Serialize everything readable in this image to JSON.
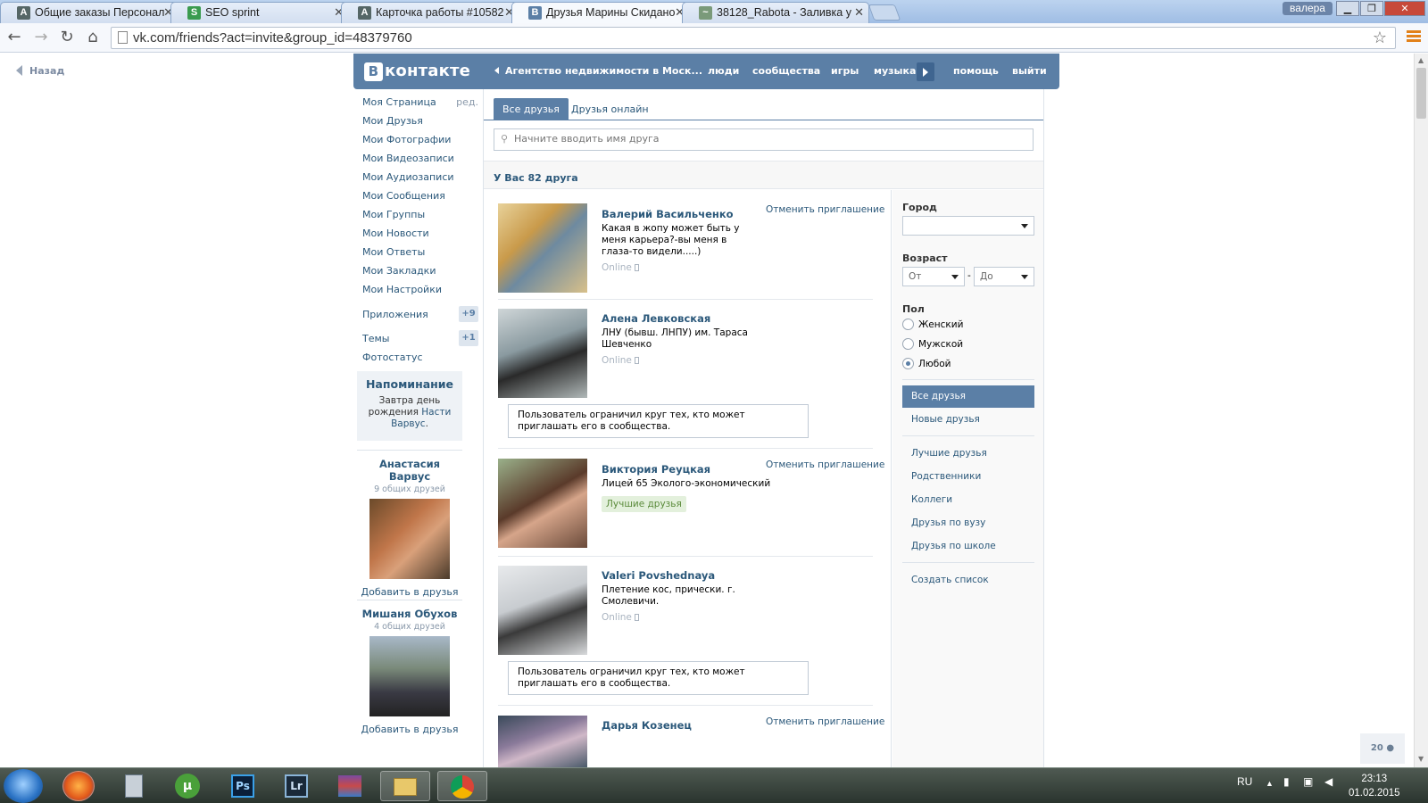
{
  "browser": {
    "tabs": [
      {
        "label": "Общие заказы Персонал",
        "icon": "A"
      },
      {
        "label": "SEO sprint",
        "icon": "S"
      },
      {
        "label": "Карточка работы #10582",
        "icon": "A"
      },
      {
        "label": "Друзья Марины Скидано",
        "icon": "B"
      },
      {
        "label": "38128_Rabota - Заливка у",
        "icon": "~"
      }
    ],
    "user": "валера",
    "url": "vk.com/friends?act=invite&group_id=48379760"
  },
  "page": {
    "back_label": "Назад",
    "logo": {
      "letter": "B",
      "text": "контакте"
    },
    "nav": {
      "group": "Агентство недвижимости в Моск...",
      "people": "люди",
      "communities": "сообщества",
      "games": "игры",
      "music": "музыка",
      "help": "помощь",
      "logout": "выйти"
    },
    "menu": {
      "edit": "ред.",
      "items": [
        "Моя Страница",
        "Мои Друзья",
        "Мои Фотографии",
        "Мои Видеозаписи",
        "Мои Аудиозаписи",
        "Мои Сообщения",
        "Мои Группы",
        "Мои Новости",
        "Мои Ответы",
        "Мои Закладки",
        "Мои Настройки"
      ],
      "apps": {
        "label": "Приложения",
        "badge": "+9"
      },
      "topics": {
        "label": "Темы",
        "badge": "+1"
      },
      "photostatus": "Фотостатус"
    },
    "reminder": {
      "title": "Напоминание",
      "line1": "Завтра",
      "line2": "день рождения",
      "link": "Насти Варвус",
      "dot": "."
    },
    "suggestions": [
      {
        "name": "Анастасия Варвус",
        "common": "9 общих друзей",
        "add": "Добавить в друзья"
      },
      {
        "name": "Мишаня Обухов",
        "common": "4 общих друзей",
        "add": "Добавить в друзья"
      }
    ],
    "tabs": {
      "all": "Все друзья",
      "online": "Друзья онлайн"
    },
    "search_placeholder": "Начните вводить имя друга",
    "count_text": "У Вас 82 друга",
    "friends": [
      {
        "name": "Валерий Васильченко",
        "info": "Какая в жопу может быть у меня карьера?-вы меня в глаза-то видели.....)",
        "online": "Online",
        "cancel": "Отменить приглашение"
      },
      {
        "name": "Алена Левковская",
        "info": "ЛНУ (бывш. ЛНПУ) им. Тараса Шевченко",
        "online": "Online",
        "notice": "Пользователь ограничил круг тех, кто может приглашать его в сообщества."
      },
      {
        "name": "Виктория Реуцкая",
        "info": "Лицей 65 Эколого-экономический",
        "best": "Лучшие друзья",
        "cancel": "Отменить приглашение"
      },
      {
        "name": "Valeri Povshednaya",
        "info": "Плетение кос, прически. г. Смолевичи.",
        "online": "Online",
        "notice": "Пользователь ограничил круг тех, кто может приглашать его в сообщества."
      },
      {
        "name": "Дарья Козенец",
        "cancel": "Отменить приглашение"
      }
    ],
    "filters": {
      "city_label": "Город",
      "city_value": "",
      "age_label": "Возраст",
      "age_from": "От",
      "age_dash": "-",
      "age_to": "До",
      "sex_label": "Пол",
      "sex_options": [
        "Женский",
        "Мужской",
        "Любой"
      ],
      "sex_selected": "Любой",
      "lists": [
        "Все друзья",
        "Новые друзья",
        "Лучшие друзья",
        "Родственники",
        "Коллеги",
        "Друзья по вузу",
        "Друзья по школе",
        "Создать список"
      ]
    },
    "pager_count": "20"
  },
  "taskbar": {
    "lang": "RU",
    "time": "23:13",
    "date": "01.02.2015",
    "apps": [
      "firefox",
      "calculator",
      "utorrent",
      "photoshop",
      "lightroom",
      "winrar",
      "explorer",
      "chrome"
    ],
    "labels": {
      "photoshop": "Ps",
      "lightroom": "Lr"
    }
  },
  "colors": {
    "vk_blue": "#5b7fa6",
    "link": "#2b587a"
  }
}
